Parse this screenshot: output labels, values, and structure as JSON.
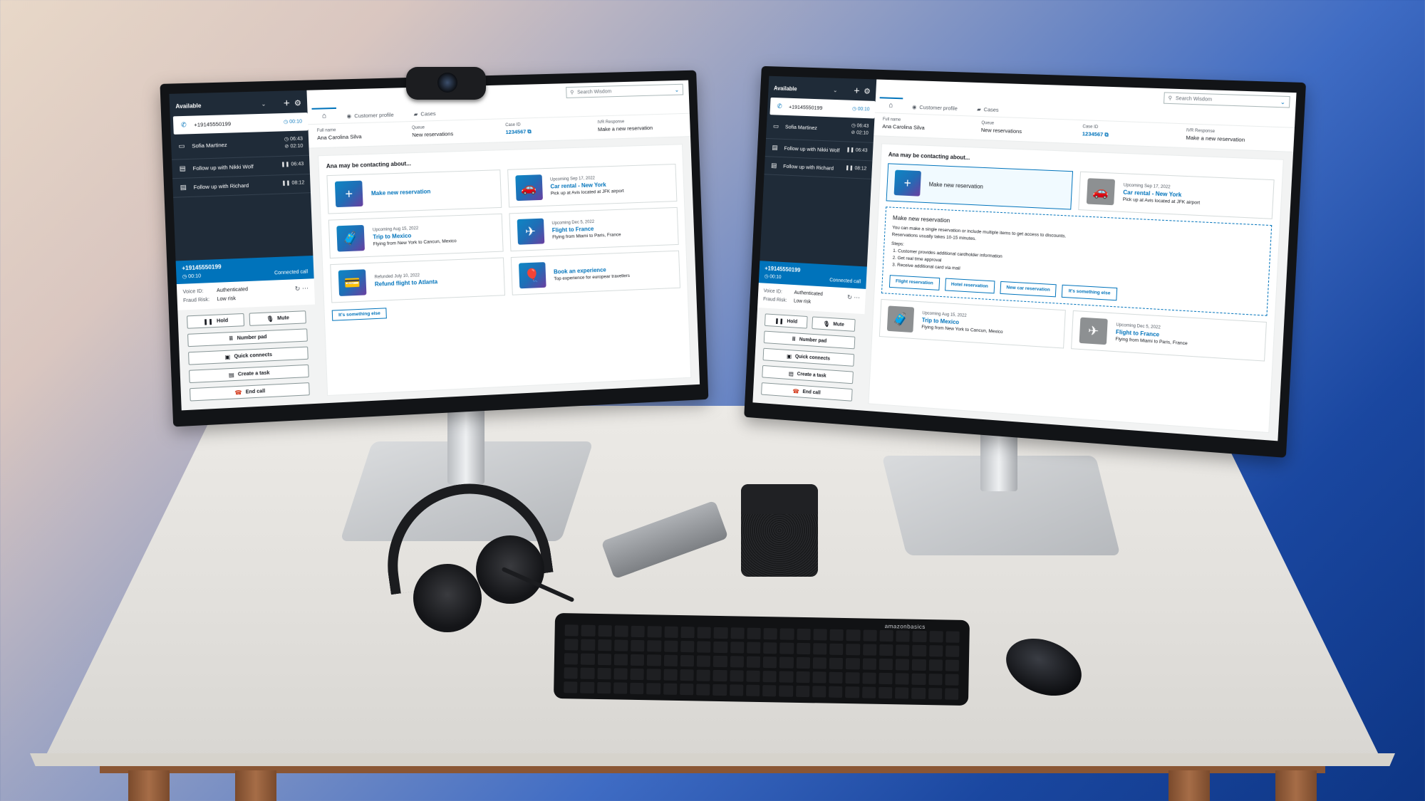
{
  "scene": {
    "description": "Two-monitor Amazon Connect agent workspace desk setup",
    "colors": {
      "accent": "#0073bb",
      "ccp_dark": "#1f2b38",
      "end_call": "#d13212",
      "bg_top_left": "#e8d8c8",
      "bg_bottom_right": "#0d3584"
    },
    "keyboard_brand": "amazonbasics"
  },
  "left_monitor": {
    "ccp": {
      "status": "Available",
      "active_contact": {
        "number": "+19145550199",
        "timer": "00:10"
      },
      "contacts": [
        {
          "icon": "chat-icon",
          "name": "Sofia Martinez",
          "time1": "06:43",
          "time2": "02:10"
        },
        {
          "icon": "task-icon",
          "name": "Follow up with Nikki Wolf",
          "time1": "06:43",
          "time2": ""
        },
        {
          "icon": "task-icon",
          "name": "Follow up with Richard",
          "time1": "08:12",
          "time2": ""
        }
      ],
      "call": {
        "number": "+19145550199",
        "timer": "00:10",
        "state": "Connected call",
        "voice_id_label": "Voice ID:",
        "voice_id": "Authenticated",
        "fraud_label": "Fraud Risk:",
        "fraud": "Low risk"
      },
      "buttons": {
        "hold": "Hold",
        "mute": "Mute",
        "number_pad": "Number pad",
        "quick_connects": "Quick connects",
        "create_task": "Create a task",
        "end_call": "End call"
      }
    },
    "workspace": {
      "search_placeholder": "Search Wisdom",
      "tabs": [
        "Customer profile",
        "Cases"
      ],
      "profile": [
        {
          "label": "Full name",
          "value": "Ana Carolina Silva"
        },
        {
          "label": "Queue",
          "value": "New reservations"
        },
        {
          "label": "Case ID",
          "value": "1234567"
        },
        {
          "label": "IVR Response",
          "value": "Make a new reservation"
        }
      ],
      "contacting_title": "Ana may be contacting about...",
      "cards": [
        {
          "icon": "plus-icon",
          "sub": "",
          "title": "Make new reservation",
          "desc": ""
        },
        {
          "icon": "car-icon",
          "sub": "Upcoming Sep 17, 2022",
          "title": "Car rental - New York",
          "desc": "Pick up at Avis located at JFK airport"
        },
        {
          "icon": "suitcase-icon",
          "sub": "Upcoming Aug 15, 2022",
          "title": "Trip to Mexico",
          "desc": "Flying from New York to Cancun, Mexico"
        },
        {
          "icon": "airplane-icon",
          "sub": "Upcoming Dec 5, 2022",
          "title": "Flight to France",
          "desc": "Flying from Miami to Paris, France"
        },
        {
          "icon": "refund-icon",
          "sub": "Refunded July 10, 2022",
          "title": "Refund flight to Atlanta",
          "desc": ""
        },
        {
          "icon": "balloon-icon",
          "sub": "",
          "title": "Book an experience",
          "desc": "Top experience for europear travellers"
        }
      ],
      "else_button": "It's something else"
    }
  },
  "right_monitor": {
    "ccp": {
      "status": "Available",
      "active_contact": {
        "number": "+19145550199",
        "timer": "00:10"
      },
      "contacts": [
        {
          "icon": "chat-icon",
          "name": "Sofia Martinez",
          "time1": "06:43",
          "time2": "02:10"
        },
        {
          "icon": "task-icon",
          "name": "Follow up with Nikki Wolf",
          "time1": "06:43",
          "time2": ""
        },
        {
          "icon": "task-icon",
          "name": "Follow up with Richard",
          "time1": "08:12",
          "time2": ""
        }
      ],
      "call": {
        "number": "+19145550199",
        "timer": "00:10",
        "state": "Connected call",
        "voice_id_label": "Voice ID:",
        "voice_id": "Authenticated",
        "fraud_label": "Fraud Risk:",
        "fraud": "Low risk"
      },
      "buttons": {
        "hold": "Hold",
        "mute": "Mute",
        "number_pad": "Number pad",
        "quick_connects": "Quick connects",
        "create_task": "Create a task",
        "end_call": "End call"
      }
    },
    "workspace": {
      "search_placeholder": "Search Wisdom",
      "tabs": [
        "Customer profile",
        "Cases"
      ],
      "profile": [
        {
          "label": "Full name",
          "value": "Ana Carolina Silva"
        },
        {
          "label": "Queue",
          "value": "New reservations"
        },
        {
          "label": "Case ID",
          "value": "1234567"
        },
        {
          "label": "IVR Response",
          "value": "Make a new reservation"
        }
      ],
      "contacting_title": "Ana may be contacting about...",
      "selected_card": {
        "title": "Make new reservation"
      },
      "car_card": {
        "sub": "Upcoming Sep 17, 2022",
        "title": "Car rental - New York",
        "desc": "Pick up at Avis located at JFK airport"
      },
      "expanded": {
        "title": "Make new reservation",
        "line1": "You can make a single reservation or include multiple items to get access to discounts.",
        "line2": "Reservations usually takes 10-15 minutes.",
        "steps_label": "Steps:",
        "steps": [
          "Customer provides additional cardholder information",
          "Get real time approval",
          "Receive additional card via mail"
        ],
        "buttons": [
          "Flight reservation",
          "Hotel reservation",
          "New car reservation",
          "It's something else"
        ]
      },
      "lower_cards": [
        {
          "sub": "Upcoming Aug 15, 2022",
          "title": "Trip to Mexico",
          "desc": "Flying from New York to Cancun, Mexico"
        },
        {
          "sub": "Upcoming Dec 5, 2022",
          "title": "Flight to France",
          "desc": "Flying from Miami to Paris, France"
        }
      ]
    }
  }
}
